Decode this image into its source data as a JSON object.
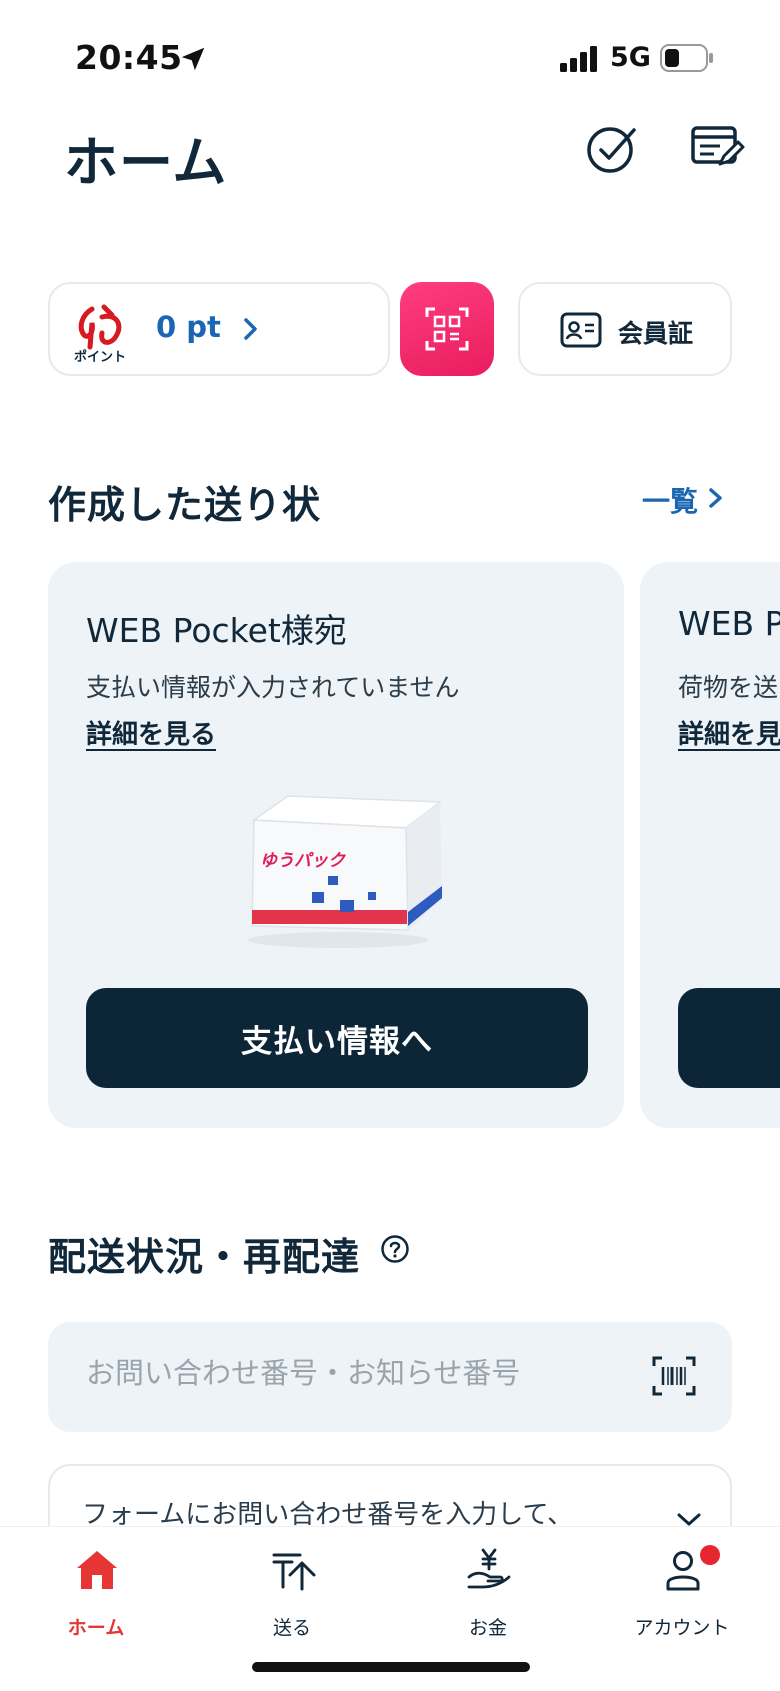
{
  "status_bar": {
    "time": "20:45",
    "network": "5G"
  },
  "header": {
    "title": "ホーム"
  },
  "points": {
    "logo_text": "ポイント",
    "value": "0 pt"
  },
  "member_card": {
    "label": "会員証"
  },
  "invoices": {
    "section_title": "作成した送り状",
    "see_all": "一覧",
    "cards": [
      {
        "title": "WEB Pocket様宛",
        "status": "支払い情報が入力されていません",
        "link": "詳細を見る",
        "button": "支払い情報へ",
        "box_logo": "ゆうパック"
      },
      {
        "title": "WEB P",
        "status": "荷物を送",
        "link": "詳細を見"
      }
    ]
  },
  "tracking": {
    "section_title": "配送状況・再配達",
    "search_placeholder": "お問い合わせ番号・お知らせ番号",
    "info_text": "フォームにお問い合わせ番号を入力して、"
  },
  "nav": {
    "items": [
      {
        "label": "ホーム",
        "icon": "home-icon",
        "active": true
      },
      {
        "label": "送る",
        "icon": "send-icon"
      },
      {
        "label": "お金",
        "icon": "money-icon"
      },
      {
        "label": "アカウント",
        "icon": "account-icon",
        "badge": true
      }
    ]
  },
  "colors": {
    "brand_pink": "#e81d5f",
    "link_blue": "#1a66b3",
    "dark_navy": "#0d2637",
    "active_red": "#e53535"
  }
}
